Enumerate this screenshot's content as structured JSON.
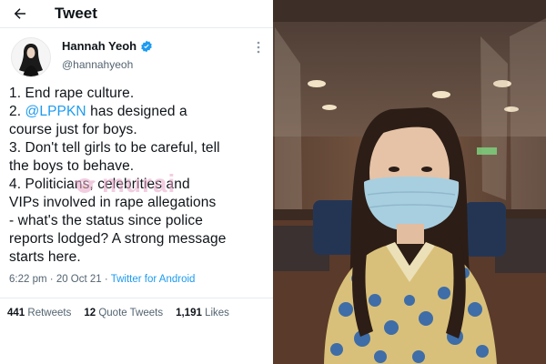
{
  "header": {
    "title": "Tweet",
    "back_icon": "arrow-left-icon"
  },
  "author": {
    "name": "Hannah Yeoh",
    "handle": "@hannahyeoh",
    "verified": true,
    "verified_icon": "verified-badge-icon",
    "more_icon": "more-vertical-icon"
  },
  "tweet": {
    "lines": [
      "1. End rape culture.",
      "has designed a",
      "course just for boys.",
      "3. Don't tell girls to be careful, tell",
      "the boys to behave.",
      "4. Politicians, celebrities and",
      "VIPs involved in rape allegations",
      "- what's the status since police",
      "reports lodged? A strong message",
      "starts here."
    ],
    "line2_prefix": "2. ",
    "mention": "@LPPKN"
  },
  "meta": {
    "time": "6:22 pm",
    "sep": "·",
    "date": "20 Oct 21",
    "client": "Twitter for Android"
  },
  "stats": {
    "retweets_count": "441",
    "retweets_label": "Retweets",
    "quotes_count": "12",
    "quotes_label": "Quote Tweets",
    "likes_count": "1,191",
    "likes_label": "Likes"
  },
  "watermark": {
    "text": "murai"
  },
  "colors": {
    "accent": "#1d9bf0",
    "text": "#0f1419",
    "muted": "#536471"
  }
}
